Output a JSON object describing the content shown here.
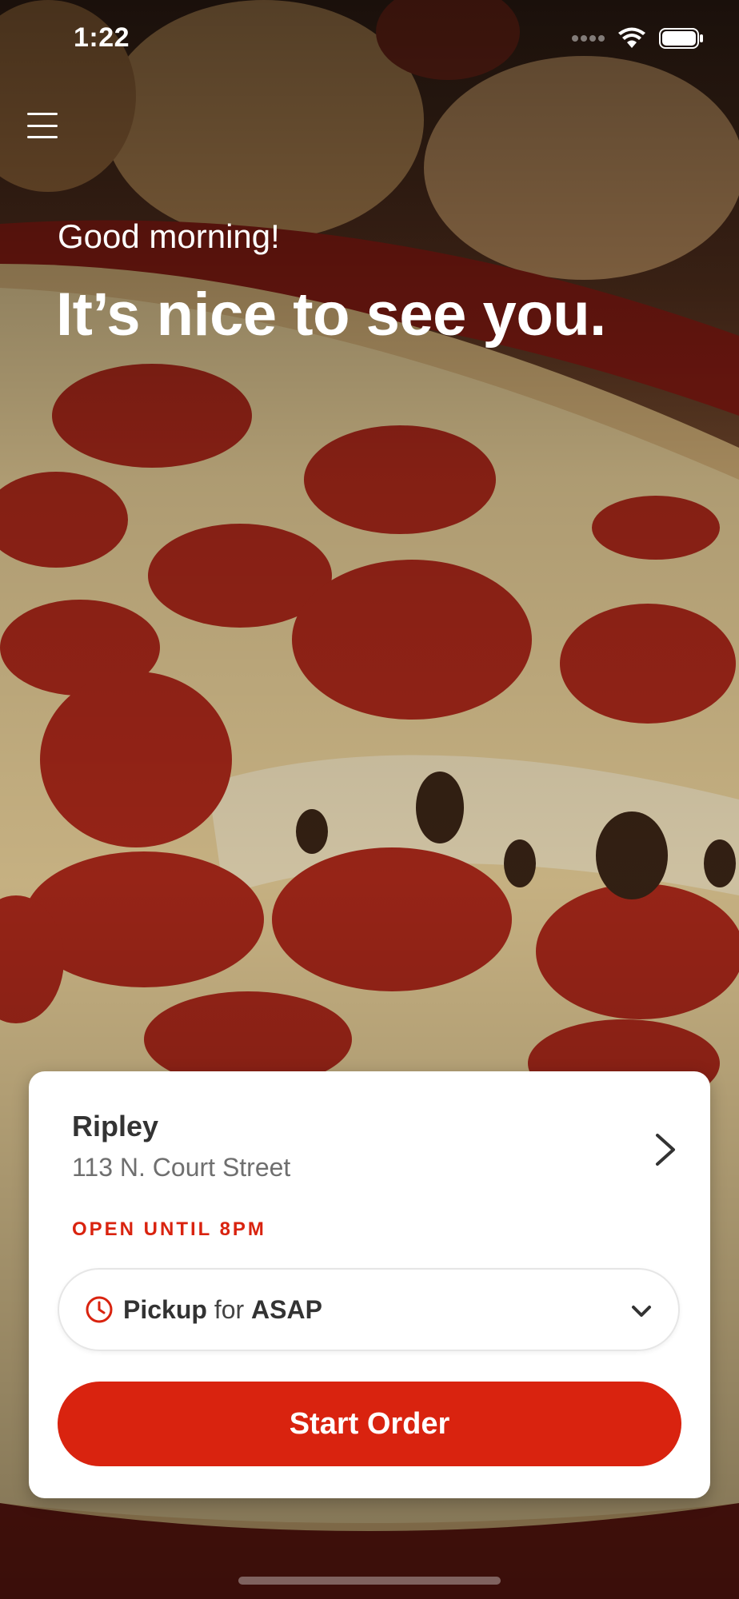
{
  "status_bar": {
    "time": "1:22",
    "icons": [
      "signal-icon",
      "wifi-icon",
      "battery-icon"
    ]
  },
  "header": {
    "menu_icon": "hamburger-menu-icon"
  },
  "hero": {
    "greeting": "Good morning!",
    "headline": "It’s nice to see you.",
    "background": "pepperoni-pizza-photo"
  },
  "store": {
    "name": "Ripley",
    "address": "113 N. Court Street",
    "hours": "OPEN UNTIL 8PM"
  },
  "order_mode": {
    "method": "Pickup",
    "connector": "for",
    "time": "ASAP"
  },
  "actions": {
    "start_order": "Start Order"
  },
  "colors": {
    "accent": "#d9230f",
    "card_background": "#ffffff",
    "text_primary": "#333333",
    "text_secondary": "#6f6f6f"
  }
}
